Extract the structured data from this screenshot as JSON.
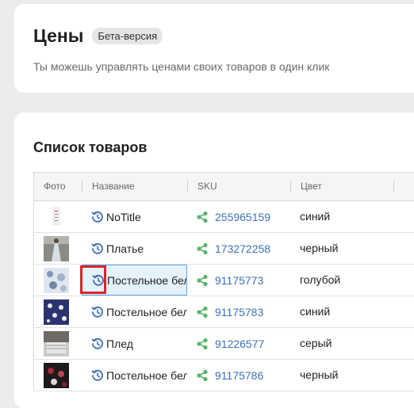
{
  "header": {
    "title": "Цены",
    "badge": "Бета-версия",
    "subtitle": "Ты можешь управлять ценами своих товаров в один клик"
  },
  "products": {
    "title": "Список товаров",
    "columns": [
      "Фото",
      "Название",
      "SKU",
      "Цвет"
    ],
    "rows": [
      {
        "name": "NoTitle",
        "sku": "255965159",
        "color": "синий"
      },
      {
        "name": "Платье",
        "sku": "173272258",
        "color": "черный"
      },
      {
        "name": "Постельное белье",
        "sku": "91175773",
        "color": "голубой"
      },
      {
        "name": "Постельное белье",
        "sku": "91175783",
        "color": "синий"
      },
      {
        "name": "Плед",
        "sku": "91226577",
        "color": "серый"
      },
      {
        "name": "Постельное белье",
        "sku": "91175786",
        "color": "черный"
      }
    ]
  },
  "icons": {
    "history": "history-icon",
    "share": "share-icon"
  },
  "colors": {
    "link": "#3d71b5",
    "share_green": "#5ab36a",
    "history_blue": "#3c6fb0",
    "highlight": "#d9262c",
    "selected_bg": "#e4f2fc"
  }
}
